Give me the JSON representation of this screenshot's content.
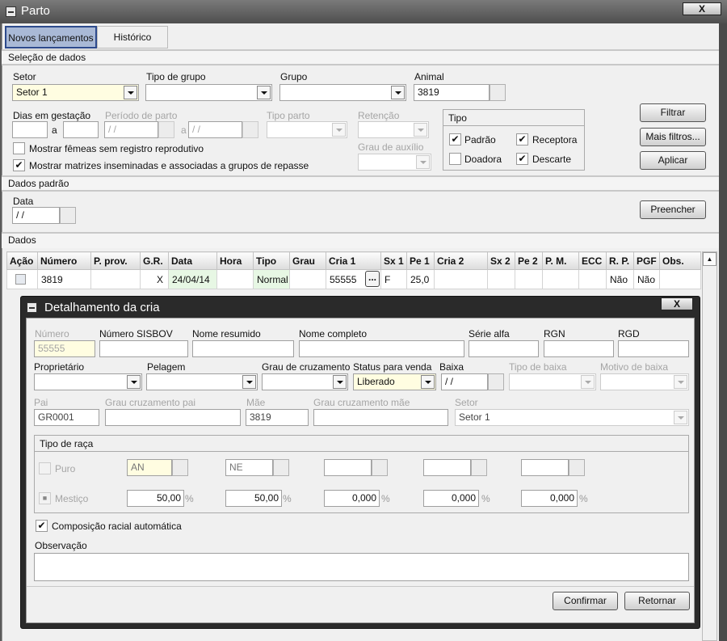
{
  "window": {
    "title": "Parto",
    "close": "X"
  },
  "tabs": [
    {
      "label": "Novos lançamentos",
      "selected": true
    },
    {
      "label": "Histórico",
      "selected": false
    }
  ],
  "selecao": {
    "title": "Seleção de dados",
    "setor_label": "Setor",
    "setor_value": "Setor 1",
    "tipo_grupo_label": "Tipo de grupo",
    "tipo_grupo_value": "",
    "grupo_label": "Grupo",
    "grupo_value": "",
    "animal_label": "Animal",
    "animal_value": "3819",
    "dias_label": "Dias em gestação",
    "a": "a",
    "periodo_label": "Período de parto",
    "periodo_de": " / /",
    "periodo_ate": " / /",
    "tipo_parto_label": "Tipo parto",
    "retencao_label": "Retenção",
    "grau_auxilio_label": "Grau de auxílio",
    "chk_femeas": {
      "label": "Mostrar fêmeas sem registro reprodutivo",
      "checked": false
    },
    "chk_matrizes": {
      "label": "Mostrar matrizes inseminadas e associadas a grupos de repasse",
      "checked": true
    },
    "tipo": {
      "title": "Tipo",
      "padrao": {
        "label": "Padrão",
        "checked": true
      },
      "receptora": {
        "label": "Receptora",
        "checked": true
      },
      "doadora": {
        "label": "Doadora",
        "checked": false
      },
      "descarte": {
        "label": "Descarte",
        "checked": true
      }
    },
    "buttons": {
      "filtrar": "Filtrar",
      "mais_filtros": "Mais filtros...",
      "aplicar": "Aplicar"
    }
  },
  "dados_padrao": {
    "title": "Dados padrão",
    "data_label": "Data",
    "data_value": " / /",
    "preencher": "Preencher"
  },
  "dados": {
    "title": "Dados",
    "columns": [
      "Ação",
      "Número",
      "P. prov.",
      "G.R.",
      "Data",
      "Hora",
      "Tipo",
      "Grau",
      "Cria 1",
      "Sx 1",
      "Pe 1",
      "Cria 2",
      "Sx 2",
      "Pe 2",
      "P. M.",
      "ECC",
      "R. P.",
      "PGF",
      "Obs."
    ],
    "rows": [
      {
        "numero": "3819",
        "p_prov": "",
        "gr": "X",
        "data": "24/04/14",
        "hora": "",
        "tipo": "Normal",
        "grau": "",
        "cria1": "55555",
        "cria1_btn": "...",
        "sx1": "F",
        "pe1": "25,0",
        "cria2": "",
        "sx2": "",
        "pe2": "",
        "pm": "",
        "ecc": "",
        "rp": "Não",
        "pgf": "Não",
        "obs": ""
      }
    ]
  },
  "dialog": {
    "title": "Detalhamento da cria",
    "close": "X",
    "numero_label": "Número",
    "numero_value": "55555",
    "sisbov_label": "Número SISBOV",
    "nome_resumido_label": "Nome resumido",
    "nome_completo_label": "Nome completo",
    "serie_alfa_label": "Série alfa",
    "rgn_label": "RGN",
    "rgd_label": "RGD",
    "proprietario_label": "Proprietário",
    "pelagem_label": "Pelagem",
    "grau_cruz_label": "Grau de cruzamento",
    "status_venda_label": "Status para venda",
    "status_venda_value": "Liberado",
    "baixa_label": "Baixa",
    "baixa_value": " / /",
    "tipo_baixa_label": "Tipo de baixa",
    "motivo_baixa_label": "Motivo de baixa",
    "pai_label": "Pai",
    "pai_value": "GR0001",
    "grau_pai_label": "Grau cruzamento pai",
    "mae_label": "Mãe",
    "mae_value": "3819",
    "grau_mae_label": "Grau cruzamento mãe",
    "setor_label": "Setor",
    "setor_value": "Setor 1",
    "raca": {
      "title": "Tipo de raça",
      "puro_label": "Puro",
      "mestico_label": "Mestiço",
      "pct": "%",
      "racas": [
        "AN",
        "NE",
        "",
        "",
        ""
      ],
      "percentuais": [
        "50,00",
        "50,00",
        "0,000",
        "0,000",
        "0,000"
      ]
    },
    "composicao": {
      "label": "Composição racial automática",
      "checked": true
    },
    "observacao_label": "Observação",
    "observacao_value": "",
    "confirmar": "Confirmar",
    "retornar": "Retornar"
  }
}
